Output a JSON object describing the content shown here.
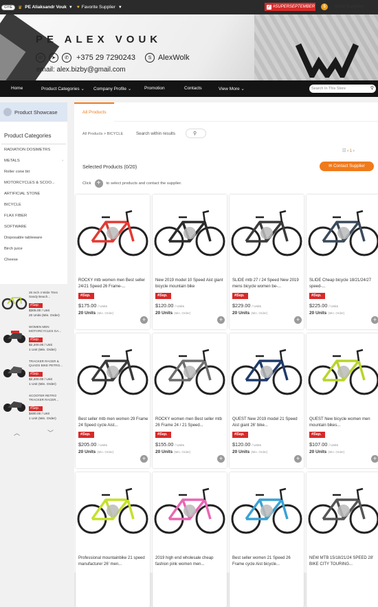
{
  "topbar": {
    "tag": "GYIE",
    "company": "PE Aliaksandr Vouk",
    "favorite": "Favorite Supplier",
    "super_september": "#SUPERSEPTEMBER",
    "gold": "Gold Supplier",
    "accent": "#d62a2a"
  },
  "banner": {
    "name": "PE ALEX VOUK",
    "phone": "+375 29 7290243",
    "skype": "AlexWolk",
    "email": "email: alex.bizby@gmail.com"
  },
  "nav": {
    "items": [
      "Home",
      "Product Categories",
      "Company Profile",
      "Promotion",
      "Contacts",
      "View More"
    ],
    "search_placeholder": "Search In This Store"
  },
  "sidebar": {
    "showcase": "Product Showcase",
    "categories_title": "Product Categories",
    "categories": [
      "RADIATION DOSIMETRS",
      "METALS",
      "Roller cone bit",
      "MOTORCYCLES & SCOO...",
      "ARTIFICIAL STONE",
      "BICYCLE",
      "FLAX FIBER",
      "SOFTWARE",
      "Disposable tableware",
      "Birch juice",
      "Cheese"
    ],
    "products": [
      {
        "title": "26 Inch 4 Wide Tires Sandy Beach...",
        "badge": "#Sep.",
        "price": "$305.00 / Unit",
        "units": "20 Units (Min. Order)"
      },
      {
        "title": "WOMEN MEN MOTORCYCLES GA...",
        "badge": "#Sep.",
        "price": "$2,200.00 / Unit",
        "units": "1 Unit (Min. Order)"
      },
      {
        "title": "TRACKER RACER & QUADS BIKE PETRO...",
        "badge": "#Sep.",
        "price": "$2,200.00 / Unit",
        "units": "1 Unit (Min. Order)"
      },
      {
        "title": "SCOOTER RETRO TRACKER RACER...",
        "badge": "#Sep.",
        "price": "$480.00 / Unit",
        "units": "1 Unit (Min. Order)"
      }
    ]
  },
  "main": {
    "tab": "All Products",
    "breadcrumb": "All Products  >  BICYCLE",
    "search_within": "Search within results",
    "pager": "1",
    "selected": "Selected Products (0/20)",
    "contact_button": "Contact Supplier",
    "click_hint_pre": "Click",
    "click_hint_post": "to select products and contact the supplier.",
    "badge": "#Sep.",
    "products": [
      {
        "title": "ROCKY mtb women men Best seller 24/21 Speed 26 Frame-...",
        "price": "$175.00",
        "unit": "/ Units",
        "units": "20 Units",
        "min": "(Min. Order)",
        "color": "#e33a32"
      },
      {
        "title": "New 2019 model 10 Speed Aist giant bicycle mountain bike",
        "price": "$120.00",
        "unit": "/ Units",
        "units": "20 Units",
        "min": "(Min. Order)",
        "color": "#2b2b2b"
      },
      {
        "title": "SLIDE mtb 27 / 24 Speed New 2019 mens bicycle women be-...",
        "price": "$229.00",
        "unit": "/ Units",
        "units": "20 Units",
        "min": "(Min. Order)",
        "color": "#3a3a3a"
      },
      {
        "title": "SLIDE Cheap bicycle 18/21/24/27 speed-...",
        "price": "$225.00",
        "unit": "/ Units",
        "units": "20 Units",
        "min": "(Min. Order)",
        "color": "#3b4a5a"
      },
      {
        "title": "Best seller mtb men women 29 Frame 24 Speed cycle Aist...",
        "price": "$205.00",
        "unit": "/ Units",
        "units": "20 Units",
        "min": "(Min. Order)",
        "color": "#3a3a3a"
      },
      {
        "title": "ROCKY women men Best seller mtb 26 Frame 24 / 21 Speed...",
        "price": "$155.00",
        "unit": "/ Units",
        "units": "20 Units",
        "min": "(Min. Order)",
        "color": "#6e6e6e"
      },
      {
        "title": "QUEST New 2019 model 21 Speed Aist giant 26' bike...",
        "price": "$120.00",
        "unit": "/ Units",
        "units": "20 Units",
        "min": "(Min. Order)",
        "color": "#1f3a6a"
      },
      {
        "title": "QUEST New bicycle women men mountain bikes...",
        "price": "$107.00",
        "unit": "/ Units",
        "units": "20 Units",
        "min": "(Min. Order)",
        "color": "#b8d52a"
      },
      {
        "title": "Professional mountainbike 21 speed manufacturer 26' men...",
        "price": "",
        "unit": "",
        "units": "",
        "min": "",
        "color": "#c7e02a"
      },
      {
        "title": "2019 high end wholesale cheap fashion pink women men...",
        "price": "",
        "unit": "",
        "units": "",
        "min": "",
        "color": "#e867b4"
      },
      {
        "title": "Best seller women 21 Speed 26 Frame cycle Aist bicycle...",
        "price": "",
        "unit": "",
        "units": "",
        "min": "",
        "color": "#3aa2d4"
      },
      {
        "title": "NEW MTB 15/18/21/24 SPEED 28' BIKE CITY TOURING...",
        "price": "",
        "unit": "",
        "units": "",
        "min": "",
        "color": "#555555"
      }
    ]
  }
}
